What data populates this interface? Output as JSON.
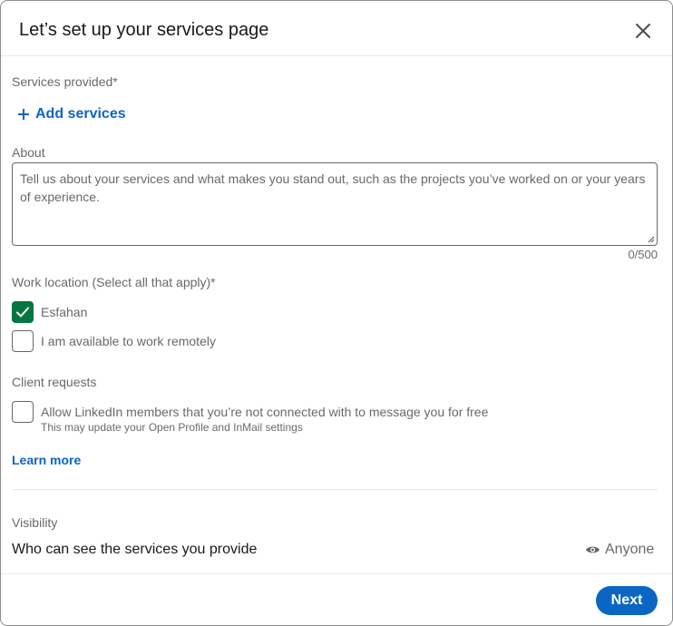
{
  "dialog": {
    "title": "Let’s set up your services page"
  },
  "services": {
    "label": "Services provided*",
    "add_label": "Add services"
  },
  "about": {
    "label": "About",
    "placeholder": "Tell us about your services and what makes you stand out, such as the projects you’ve worked on or your years of experience.",
    "value": "",
    "counter": "0/500"
  },
  "work_location": {
    "label": "Work location (Select all that apply)*",
    "options": [
      {
        "label": "Esfahan",
        "checked": true
      },
      {
        "label": "I am available to work remotely",
        "checked": false
      }
    ]
  },
  "client_requests": {
    "label": "Client requests",
    "option_label": "Allow LinkedIn members that you’re not connected with to message you for free",
    "option_sublabel": "This may update your Open Profile and InMail settings",
    "checked": false,
    "learn_more": "Learn more"
  },
  "visibility": {
    "label": "Visibility",
    "question": "Who can see the services you provide",
    "value": "Anyone",
    "icon": "eye-icon"
  },
  "footer": {
    "next_label": "Next"
  },
  "colors": {
    "accent": "#0a66c2",
    "checked": "#057642"
  }
}
